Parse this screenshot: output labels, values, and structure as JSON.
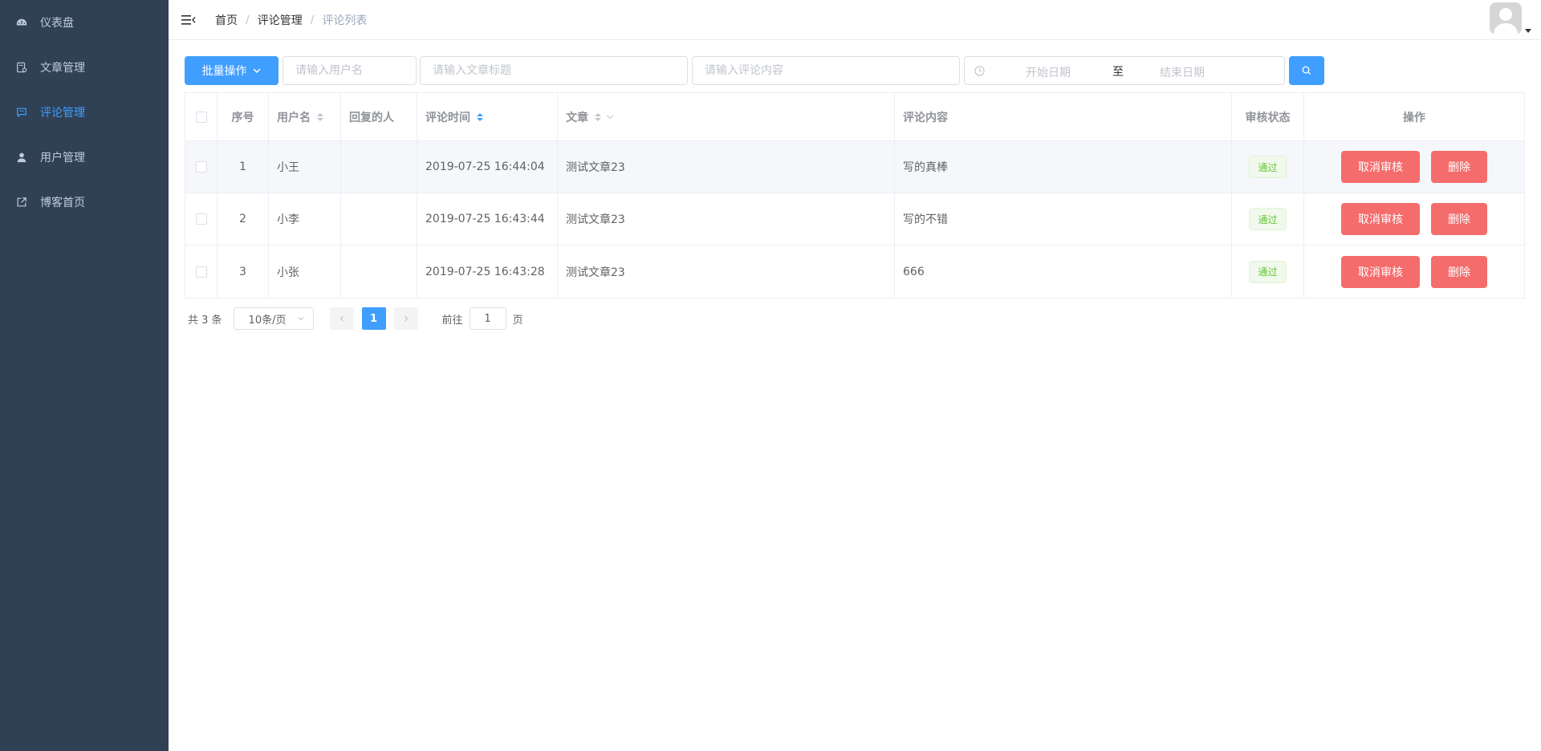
{
  "sidebar": {
    "items": [
      {
        "label": "仪表盘",
        "icon": "dashboard-icon",
        "active": false
      },
      {
        "label": "文章管理",
        "icon": "article-icon",
        "active": false
      },
      {
        "label": "评论管理",
        "icon": "comment-icon",
        "active": true
      },
      {
        "label": "用户管理",
        "icon": "user-icon",
        "active": false
      },
      {
        "label": "博客首页",
        "icon": "external-link-icon",
        "active": false
      }
    ]
  },
  "breadcrumb": [
    "首页",
    "评论管理",
    "评论列表"
  ],
  "breadcrumb_sep": "/",
  "filters": {
    "batch_label": "批量操作",
    "username_placeholder": "请输入用户名",
    "title_placeholder": "请输入文章标题",
    "content_placeholder": "请输入评论内容",
    "start_date_placeholder": "开始日期",
    "date_sep": "至",
    "end_date_placeholder": "结束日期"
  },
  "table": {
    "headers": {
      "index": "序号",
      "username": "用户名",
      "reply_to": "回复的人",
      "time": "评论时间",
      "article": "文章",
      "content": "评论内容",
      "status": "审核状态",
      "actions": "操作"
    },
    "rows": [
      {
        "index": "1",
        "username": "小王",
        "reply_to": "",
        "time": "2019-07-25 16:44:04",
        "article": "测试文章23",
        "content": "写的真棒",
        "status": "通过",
        "cancel": "取消审核",
        "delete": "删除"
      },
      {
        "index": "2",
        "username": "小李",
        "reply_to": "",
        "time": "2019-07-25 16:43:44",
        "article": "测试文章23",
        "content": "写的不错",
        "status": "通过",
        "cancel": "取消审核",
        "delete": "删除"
      },
      {
        "index": "3",
        "username": "小张",
        "reply_to": "",
        "time": "2019-07-25 16:43:28",
        "article": "测试文章23",
        "content": "666",
        "status": "通过",
        "cancel": "取消审核",
        "delete": "删除"
      }
    ]
  },
  "pagination": {
    "total": "共 3 条",
    "page_size": "10条/页",
    "current_page": "1",
    "goto_prefix": "前往",
    "goto_value": "1",
    "goto_suffix": "页"
  },
  "colors": {
    "sidebar_bg": "#304156",
    "sidebar_text": "#bfcbd9",
    "primary": "#409eff",
    "danger": "#f56c6c",
    "success": "#67c23a"
  }
}
